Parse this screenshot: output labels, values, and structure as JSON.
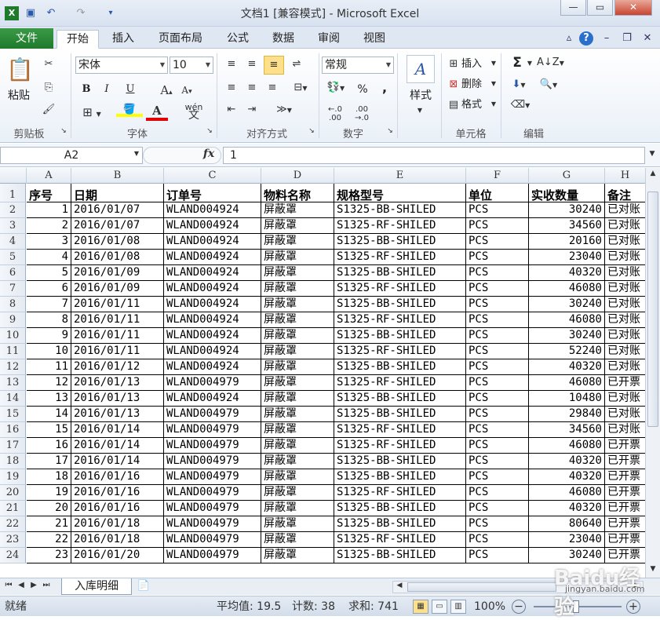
{
  "window": {
    "title": "文档1  [兼容模式] - Microsoft Excel",
    "minimize": "—",
    "restore": "▭",
    "close": "✕"
  },
  "quick_access": {
    "save_icon": "save-icon",
    "undo_icon": "undo-icon",
    "redo_icon": "redo-icon"
  },
  "tabs": [
    "文件",
    "开始",
    "插入",
    "页面布局",
    "公式",
    "数据",
    "审阅",
    "视图"
  ],
  "ribbon": {
    "clipboard": {
      "paste": "粘贴",
      "label": "剪贴板"
    },
    "font": {
      "name": "宋体",
      "size": "10",
      "label": "字体",
      "bold": "B",
      "italic": "I",
      "underline": "U",
      "wen": "wén\n文"
    },
    "alignment": {
      "label": "对齐方式"
    },
    "number": {
      "format": "常规",
      "label": "数字",
      "percent": "%",
      "comma": ","
    },
    "styles": {
      "label": "样式"
    },
    "cells": {
      "insert": "插入",
      "delete": "删除",
      "format": "格式",
      "label": "单元格"
    },
    "editing": {
      "sum": "Σ",
      "label": "编辑"
    }
  },
  "formula_bar": {
    "name_box": "A2",
    "fx": "fx",
    "value": "1"
  },
  "columns": [
    "A",
    "B",
    "C",
    "D",
    "E",
    "F",
    "G",
    "H"
  ],
  "header_row": {
    "row": "1",
    "cells": [
      "序号",
      "日期",
      "订单号",
      "物料名称",
      "规格型号",
      "单位",
      "实收数量",
      "备注"
    ]
  },
  "rows": [
    [
      "2",
      "1",
      "2016/01/07",
      "WLAND004924",
      "屏蔽罩",
      "S1325-BB-SHILED",
      "PCS",
      "30240",
      "已对账"
    ],
    [
      "3",
      "2",
      "2016/01/07",
      "WLAND004924",
      "屏蔽罩",
      "S1325-RF-SHILED",
      "PCS",
      "34560",
      "已对账"
    ],
    [
      "4",
      "3",
      "2016/01/08",
      "WLAND004924",
      "屏蔽罩",
      "S1325-BB-SHILED",
      "PCS",
      "20160",
      "已对账"
    ],
    [
      "5",
      "4",
      "2016/01/08",
      "WLAND004924",
      "屏蔽罩",
      "S1325-RF-SHILED",
      "PCS",
      "23040",
      "已对账"
    ],
    [
      "6",
      "5",
      "2016/01/09",
      "WLAND004924",
      "屏蔽罩",
      "S1325-BB-SHILED",
      "PCS",
      "40320",
      "已对账"
    ],
    [
      "7",
      "6",
      "2016/01/09",
      "WLAND004924",
      "屏蔽罩",
      "S1325-RF-SHILED",
      "PCS",
      "46080",
      "已对账"
    ],
    [
      "8",
      "7",
      "2016/01/11",
      "WLAND004924",
      "屏蔽罩",
      "S1325-BB-SHILED",
      "PCS",
      "30240",
      "已对账"
    ],
    [
      "9",
      "8",
      "2016/01/11",
      "WLAND004924",
      "屏蔽罩",
      "S1325-RF-SHILED",
      "PCS",
      "46080",
      "已对账"
    ],
    [
      "10",
      "9",
      "2016/01/11",
      "WLAND004924",
      "屏蔽罩",
      "S1325-BB-SHILED",
      "PCS",
      "30240",
      "已对账"
    ],
    [
      "11",
      "10",
      "2016/01/11",
      "WLAND004924",
      "屏蔽罩",
      "S1325-RF-SHILED",
      "PCS",
      "52240",
      "已对账"
    ],
    [
      "12",
      "11",
      "2016/01/12",
      "WLAND004924",
      "屏蔽罩",
      "S1325-BB-SHILED",
      "PCS",
      "40320",
      "已对账"
    ],
    [
      "13",
      "12",
      "2016/01/13",
      "WLAND004979",
      "屏蔽罩",
      "S1325-RF-SHILED",
      "PCS",
      "46080",
      "已开票"
    ],
    [
      "14",
      "13",
      "2016/01/13",
      "WLAND004924",
      "屏蔽罩",
      "S1325-BB-SHILED",
      "PCS",
      "10480",
      "已对账"
    ],
    [
      "15",
      "14",
      "2016/01/13",
      "WLAND004979",
      "屏蔽罩",
      "S1325-BB-SHILED",
      "PCS",
      "29840",
      "已对账"
    ],
    [
      "16",
      "15",
      "2016/01/14",
      "WLAND004979",
      "屏蔽罩",
      "S1325-RF-SHILED",
      "PCS",
      "34560",
      "已对账"
    ],
    [
      "17",
      "16",
      "2016/01/14",
      "WLAND004979",
      "屏蔽罩",
      "S1325-RF-SHILED",
      "PCS",
      "46080",
      "已开票"
    ],
    [
      "18",
      "17",
      "2016/01/14",
      "WLAND004979",
      "屏蔽罩",
      "S1325-BB-SHILED",
      "PCS",
      "40320",
      "已开票"
    ],
    [
      "19",
      "18",
      "2016/01/16",
      "WLAND004979",
      "屏蔽罩",
      "S1325-BB-SHILED",
      "PCS",
      "40320",
      "已开票"
    ],
    [
      "20",
      "19",
      "2016/01/16",
      "WLAND004979",
      "屏蔽罩",
      "S1325-RF-SHILED",
      "PCS",
      "46080",
      "已开票"
    ],
    [
      "21",
      "20",
      "2016/01/16",
      "WLAND004979",
      "屏蔽罩",
      "S1325-BB-SHILED",
      "PCS",
      "40320",
      "已开票"
    ],
    [
      "22",
      "21",
      "2016/01/18",
      "WLAND004979",
      "屏蔽罩",
      "S1325-BB-SHILED",
      "PCS",
      "80640",
      "已开票"
    ],
    [
      "23",
      "22",
      "2016/01/18",
      "WLAND004979",
      "屏蔽罩",
      "S1325-RF-SHILED",
      "PCS",
      "23040",
      "已开票"
    ],
    [
      "24",
      "23",
      "2016/01/20",
      "WLAND004979",
      "屏蔽罩",
      "S1325-BB-SHILED",
      "PCS",
      "30240",
      "已开票"
    ]
  ],
  "sheet": {
    "name": "入库明细"
  },
  "status": {
    "ready": "就绪",
    "average": "平均值: 19.5",
    "count": "计数: 38",
    "sum": "求和: 741",
    "zoom": "100%"
  },
  "watermark": {
    "logo": "Baidu经验",
    "url": "jingyan.baidu.com"
  }
}
